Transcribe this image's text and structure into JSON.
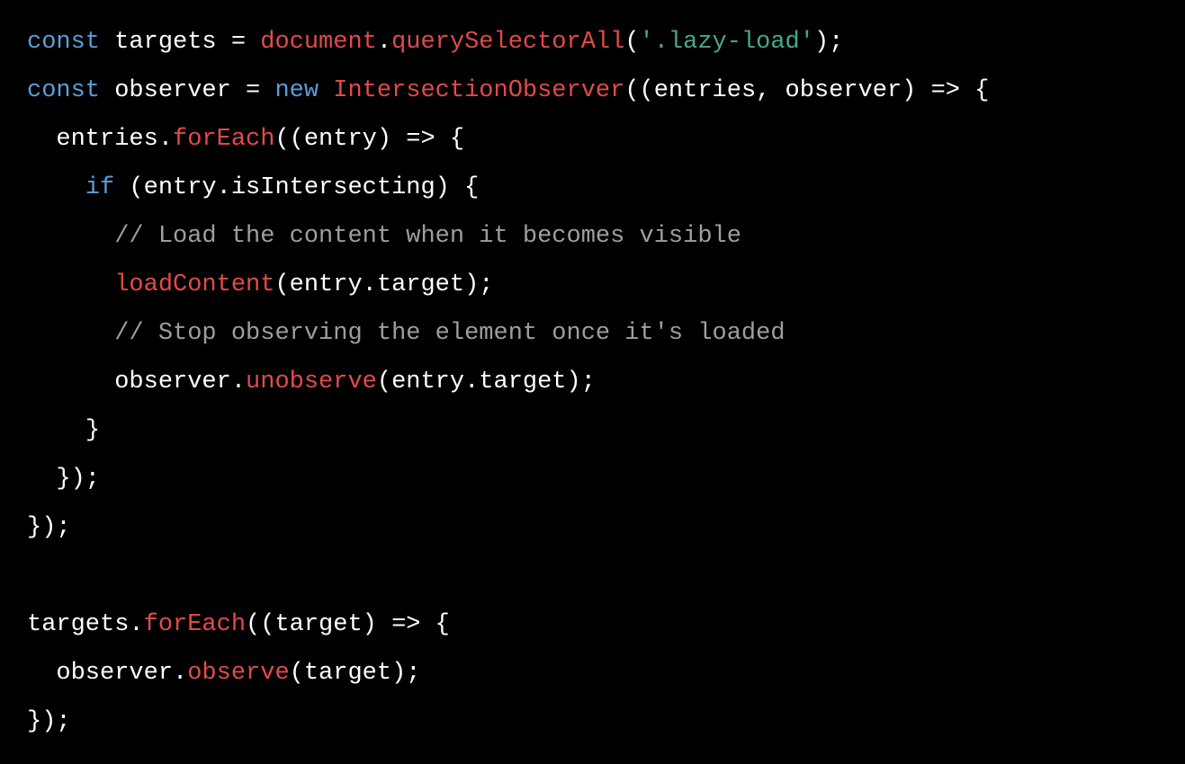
{
  "code": {
    "l1": {
      "const": "const",
      "targets": " targets ",
      "eq": "= ",
      "document": "document",
      "dot1": ".",
      "querySelectorAll": "querySelectorAll",
      "paren_open": "(",
      "str": "'.lazy-load'",
      "paren_close": ");"
    },
    "l2": {
      "const": "const",
      "observer": " observer ",
      "eq": "= ",
      "new": "new",
      "sp": " ",
      "IntersectionObserver": "IntersectionObserver",
      "rest": "((entries, observer) => {"
    },
    "l3": {
      "indent": "  ",
      "entries": "entries.",
      "forEach": "forEach",
      "rest": "((entry) => {"
    },
    "l4": {
      "indent": "    ",
      "if": "if",
      "rest": " (entry.isIntersecting) {"
    },
    "l5": {
      "indent": "      ",
      "comment": "// Load the content when it becomes visible"
    },
    "l6": {
      "indent": "      ",
      "loadContent": "loadContent",
      "rest": "(entry.target);"
    },
    "l7": {
      "indent": "      ",
      "comment": "// Stop observing the element once it's loaded"
    },
    "l8": {
      "indent": "      ",
      "observer": "observer.",
      "unobserve": "unobserve",
      "rest": "(entry.target);"
    },
    "l9": {
      "indent": "    ",
      "brace": "}"
    },
    "l10": {
      "indent": "  ",
      "rest": "});"
    },
    "l11": {
      "rest": "});"
    },
    "l12": {
      "blank": ""
    },
    "l13": {
      "targets": "targets.",
      "forEach": "forEach",
      "rest": "((target) => {"
    },
    "l14": {
      "indent": "  ",
      "observer": "observer.",
      "observe": "observe",
      "rest": "(target);"
    },
    "l15": {
      "rest": "});"
    }
  }
}
